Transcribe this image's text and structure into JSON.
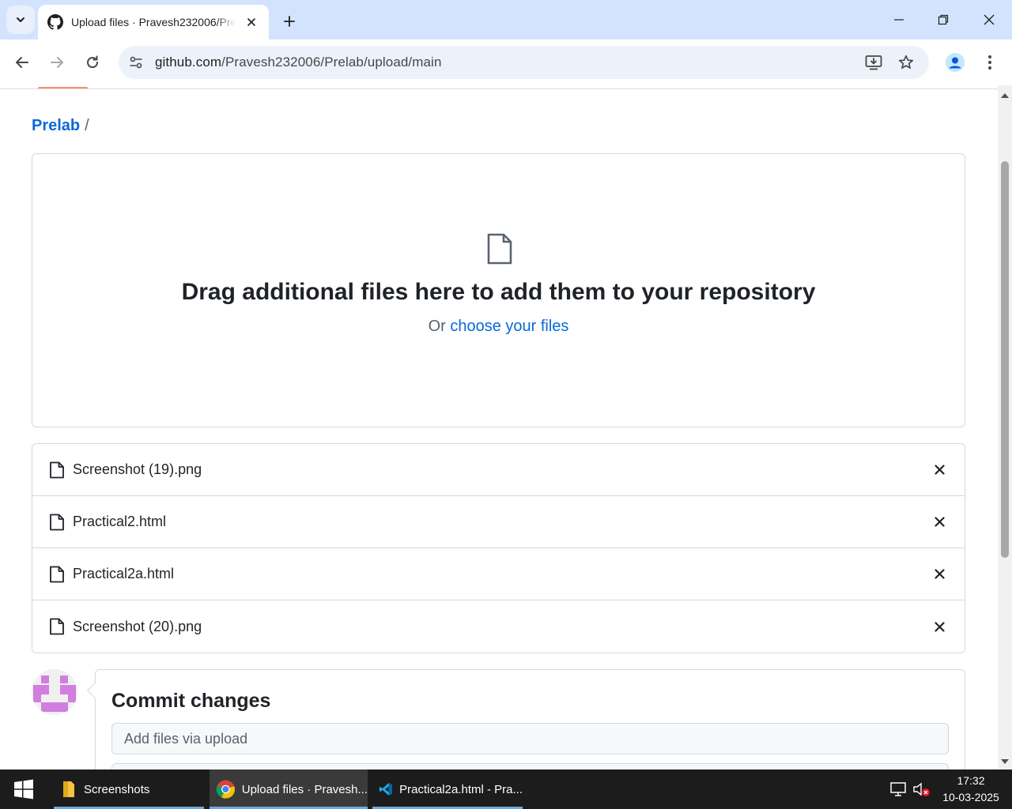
{
  "browser": {
    "tab_title": "Upload files · Pravesh232006/Prelab",
    "url_host": "github.com",
    "url_path": "/Pravesh232006/Prelab/upload/main"
  },
  "breadcrumb": {
    "repo": "Prelab",
    "separator": "/"
  },
  "dropzone": {
    "title": "Drag additional files here to add them to your repository",
    "prefix": "Or",
    "link": "choose your files"
  },
  "files": [
    {
      "name": "Screenshot (19).png"
    },
    {
      "name": "Practical2.html"
    },
    {
      "name": "Practical2a.html"
    },
    {
      "name": "Screenshot (20).png"
    }
  ],
  "commit": {
    "title": "Commit changes",
    "summary_placeholder": "Add files via upload"
  },
  "taskbar": {
    "items": [
      {
        "label": "Screenshots",
        "icon": "folder-icon"
      },
      {
        "label": "Upload files · Pravesh...",
        "icon": "chrome-icon"
      },
      {
        "label": "Practical2a.html - Pra...",
        "icon": "vscode-icon"
      }
    ],
    "time": "17:32",
    "date": "10-03-2025"
  },
  "colors": {
    "accent_link": "#0969da",
    "tabstrip": "#d3e3fd",
    "taskbar": "#1c1c1c"
  }
}
